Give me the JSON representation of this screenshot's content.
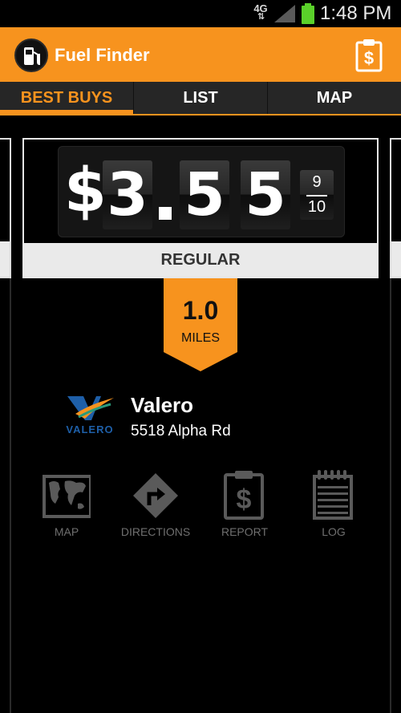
{
  "status_bar": {
    "network": "4G",
    "network_arrows": "⇅",
    "time": "1:48 PM"
  },
  "action_bar": {
    "title": "Fuel Finder"
  },
  "tabs": [
    {
      "label": "BEST BUYS",
      "active": true
    },
    {
      "label": "LIST",
      "active": false
    },
    {
      "label": "MAP",
      "active": false
    }
  ],
  "price": {
    "currency": "$",
    "digit1": "3",
    "digit2": "5",
    "digit3": "5",
    "fraction_numerator": "9",
    "fraction_denominator": "10",
    "grade": "REGULAR"
  },
  "distance": {
    "value": "1.0",
    "unit": "MILES"
  },
  "station": {
    "brand_logo_text": "VALERO",
    "name": "Valero",
    "address": "5518 Alpha Rd"
  },
  "actions": [
    {
      "label": "MAP"
    },
    {
      "label": "DIRECTIONS"
    },
    {
      "label": "REPORT"
    },
    {
      "label": "LOG"
    }
  ],
  "colors": {
    "accent": "#f7931e",
    "tab_bar": "#262626",
    "grade_bar": "#eaeaea",
    "action_icon": "#5a5a5a",
    "battery": "#5ad02a",
    "valero_blue": "#1e5fa8",
    "valero_orange": "#f7931e"
  }
}
